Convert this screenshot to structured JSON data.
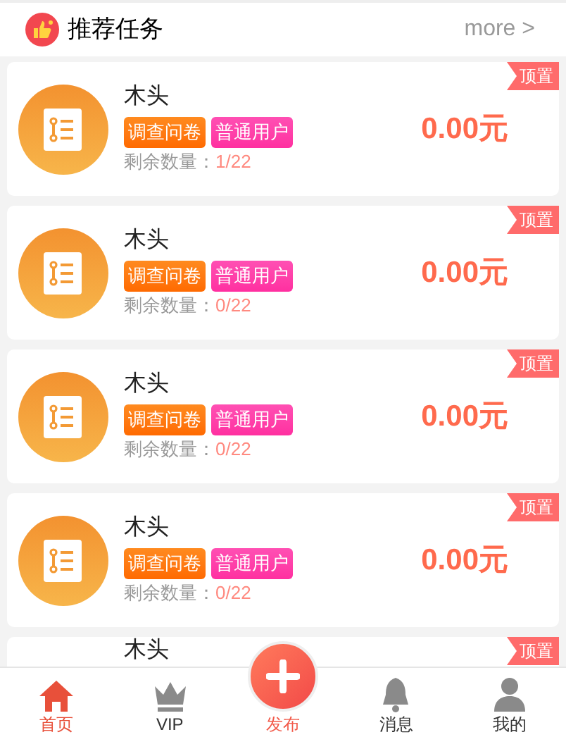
{
  "header": {
    "title": "推荐任务",
    "more": "more >"
  },
  "tasks": [
    {
      "title": "木头",
      "tags": [
        "调查问卷",
        "普通用户"
      ],
      "remaining_label": "剩余数量：",
      "remaining": "1/22",
      "price": "0.00元",
      "pin": "顶置"
    },
    {
      "title": "木头",
      "tags": [
        "调查问卷",
        "普通用户"
      ],
      "remaining_label": "剩余数量：",
      "remaining": "0/22",
      "price": "0.00元",
      "pin": "顶置"
    },
    {
      "title": "木头",
      "tags": [
        "调查问卷",
        "普通用户"
      ],
      "remaining_label": "剩余数量：",
      "remaining": "0/22",
      "price": "0.00元",
      "pin": "顶置"
    },
    {
      "title": "木头",
      "tags": [
        "调查问卷",
        "普通用户"
      ],
      "remaining_label": "剩余数量：",
      "remaining": "0/22",
      "price": "0.00元",
      "pin": "顶置"
    },
    {
      "title": "木头",
      "pin": "顶置"
    }
  ],
  "nav": [
    {
      "kind": "home",
      "label": "首页",
      "selected": true
    },
    {
      "kind": "vip",
      "label": "VIP",
      "selected": false
    },
    {
      "kind": "publish",
      "label": "发布",
      "selected": false
    },
    {
      "kind": "bell",
      "label": "消息",
      "selected": false
    },
    {
      "kind": "user",
      "label": "我的",
      "selected": false
    }
  ]
}
